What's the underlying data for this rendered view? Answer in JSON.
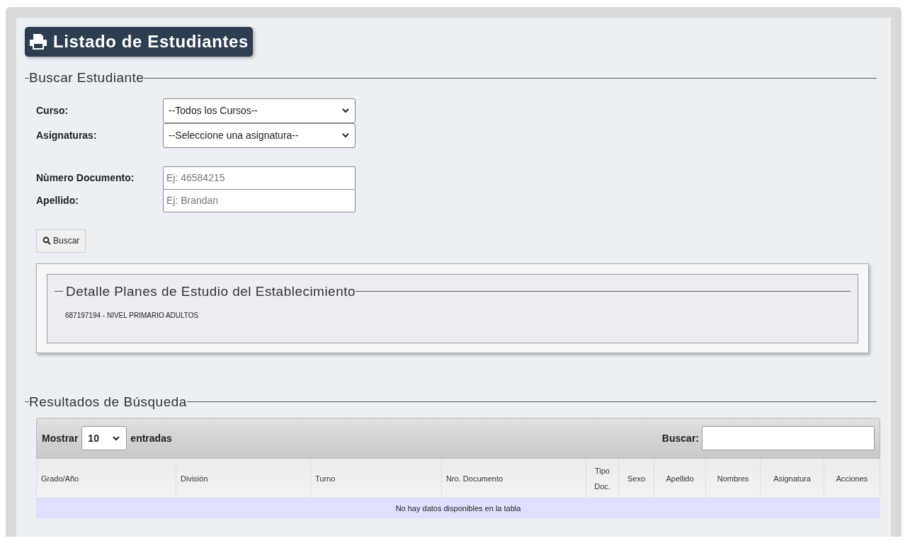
{
  "title": "Listado de Estudiantes",
  "search_section": {
    "legend": "Buscar Estudiante",
    "fields": [
      {
        "kind": "select",
        "label": "Curso:",
        "value": "--Todos los Cursos--"
      },
      {
        "kind": "select",
        "label": "Asignaturas:",
        "value": "--Seleccione una asignatura--"
      },
      {
        "kind": "input",
        "label": "Nùmero Documento:",
        "placeholder": "Ej: 46584215"
      },
      {
        "kind": "input",
        "label": "Apellido:",
        "placeholder": "Ej: Brandan"
      }
    ],
    "search_button": "Buscar"
  },
  "plans": {
    "legend": "Detalle Planes de Estudio del Establecimiento",
    "items": [
      "687197194 - NIVEL PRIMARIO ADULTOS"
    ]
  },
  "results": {
    "legend": "Resultados de Búsqueda",
    "show_label": "Mostrar",
    "page_size": "10",
    "entries_label": "entradas",
    "search_label": "Buscar:",
    "columns": [
      "Grado/Año",
      "División",
      "Turno",
      "Nro. Documento",
      "Tipo Doc.",
      "Sexo",
      "Apellido",
      "Nombres",
      "Asignatura",
      "Acciones"
    ],
    "empty_message": "No hay datos disponibles en la tabla"
  }
}
